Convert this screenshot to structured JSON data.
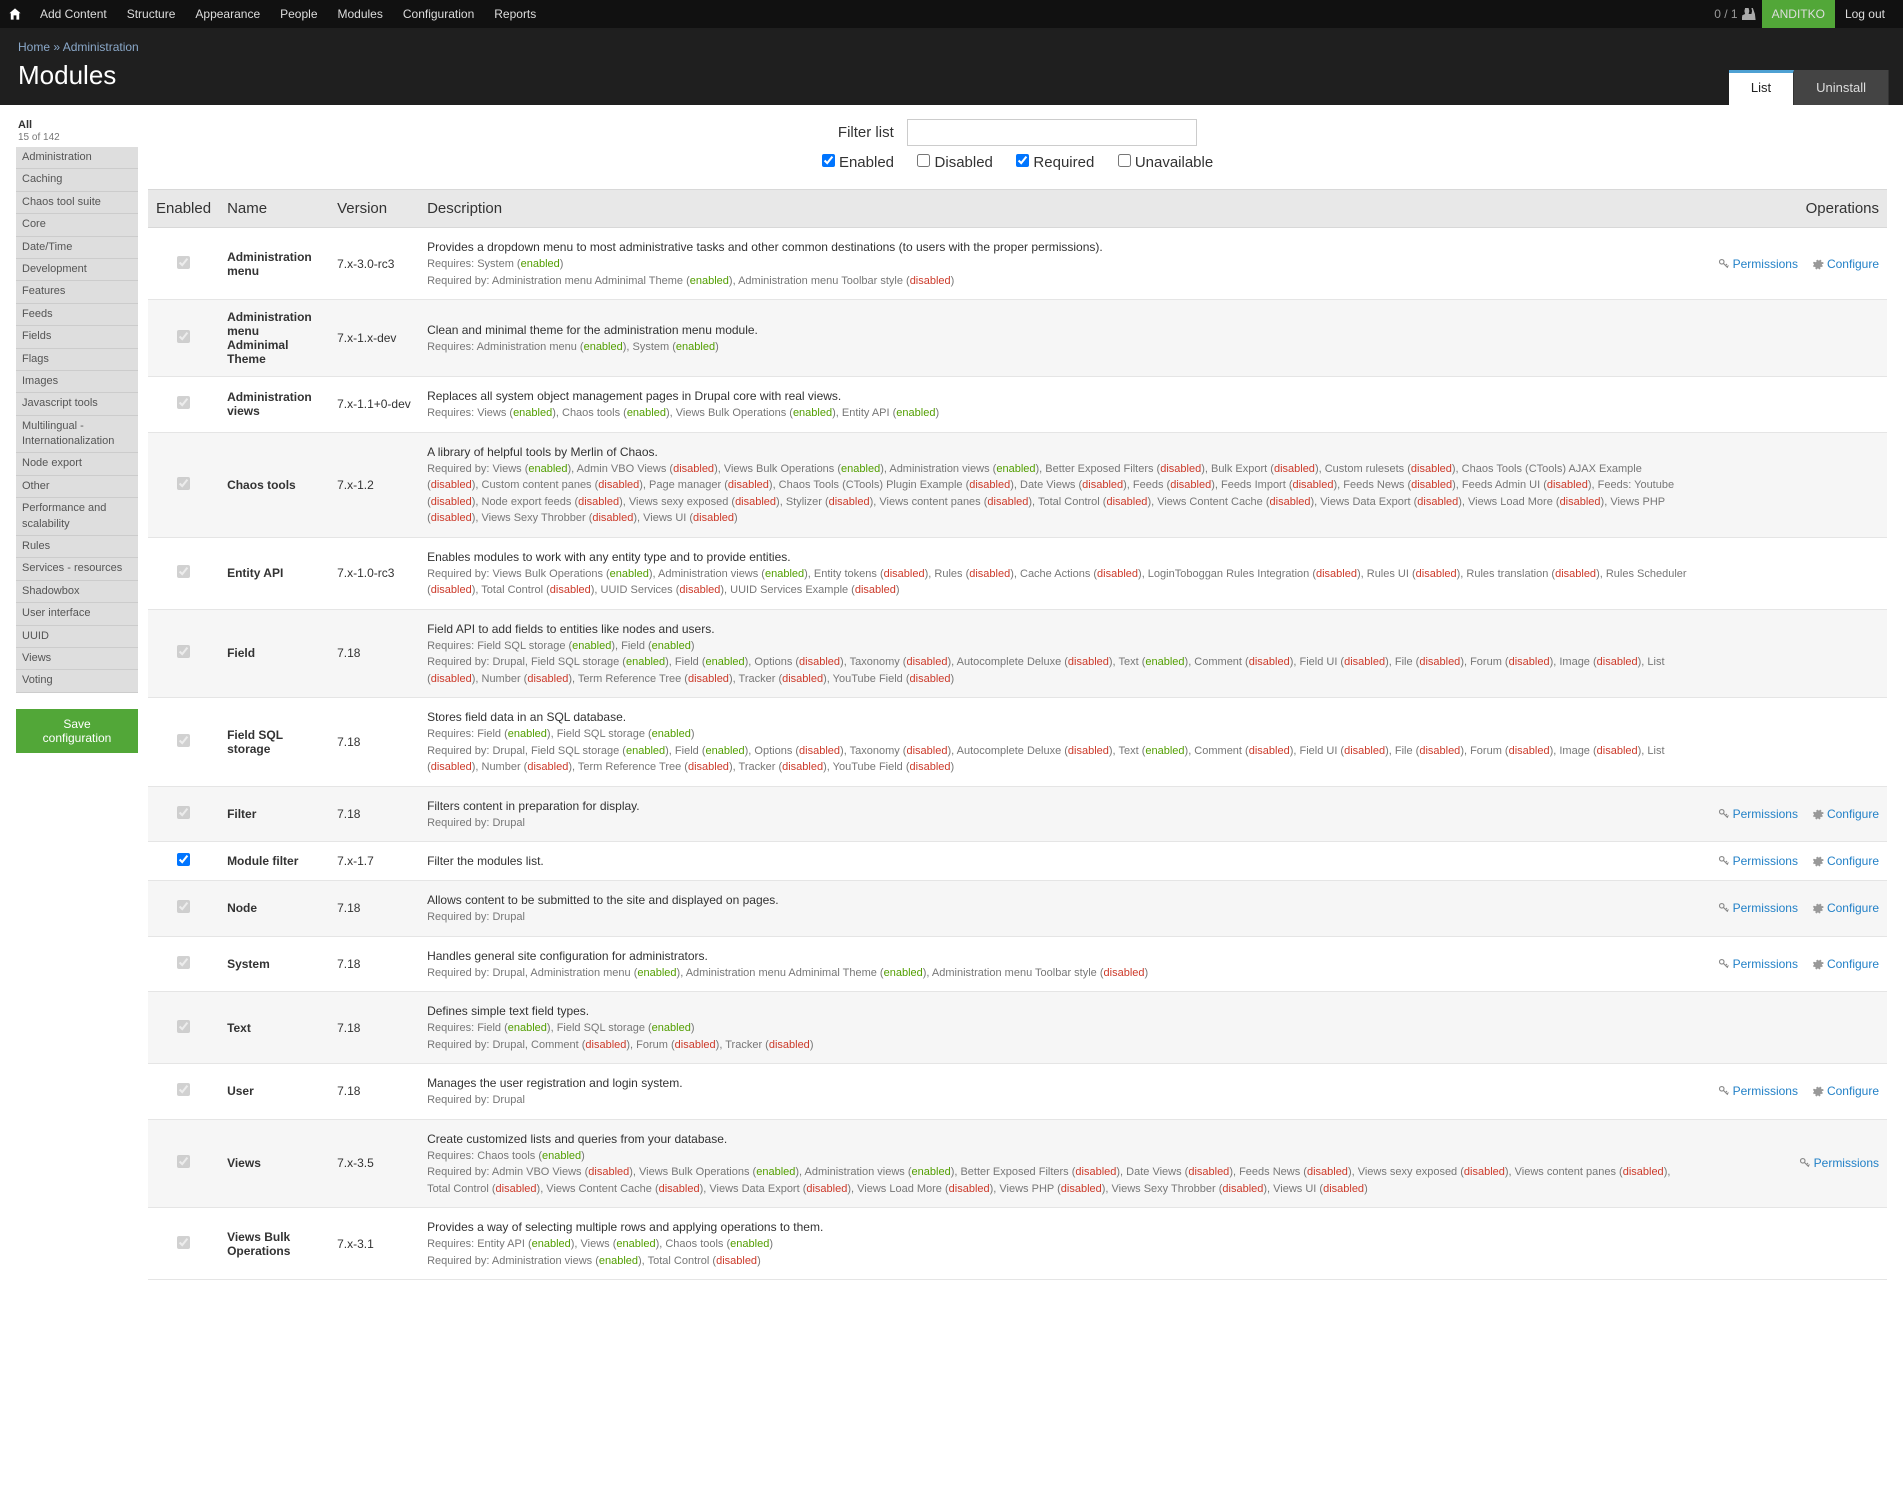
{
  "adminBar": {
    "links": [
      "Add Content",
      "Structure",
      "Appearance",
      "People",
      "Modules",
      "Configuration",
      "Reports"
    ],
    "userCount": "0 / 1",
    "username": "ANDITKO",
    "logout": "Log out"
  },
  "breadcrumb": {
    "home": "Home",
    "sep": " » ",
    "current": "Administration"
  },
  "pageTitle": "Modules",
  "tabs": {
    "list": "List",
    "uninstall": "Uninstall"
  },
  "sidebar": {
    "allLabel": "All",
    "allCount": "15 of 142",
    "items": [
      "Administration",
      "Caching",
      "Chaos tool suite",
      "Core",
      "Date/Time",
      "Development",
      "Features",
      "Feeds",
      "Fields",
      "Flags",
      "Images",
      "Javascript tools",
      "Multilingual - Internationalization",
      "Node export",
      "Other",
      "Performance and scalability",
      "Rules",
      "Services - resources",
      "Shadowbox",
      "User interface",
      "UUID",
      "Views",
      "Voting"
    ],
    "saveBtn": "Save configuration"
  },
  "filter": {
    "label": "Filter list",
    "chkEnabled": "Enabled",
    "chkDisabled": "Disabled",
    "chkRequired": "Required",
    "chkUnavailable": "Unavailable"
  },
  "columns": {
    "enabled": "Enabled",
    "name": "Name",
    "version": "Version",
    "description": "Description",
    "operations": "Operations"
  },
  "ops": {
    "permissions": "Permissions",
    "configure": "Configure"
  },
  "status": {
    "enabled": "enabled",
    "disabled": "disabled"
  },
  "rows": [
    {
      "name": "Administration menu",
      "version": "7.x-3.0-rc3",
      "desc": "Provides a dropdown menu to most administrative tasks and other common destinations (to users with the proper permissions).",
      "reqLines": [
        [
          {
            "t": "Requires: System ("
          },
          {
            "s": "en"
          },
          {
            "t": ")"
          }
        ],
        [
          {
            "t": "Required by: Administration menu Adminimal Theme ("
          },
          {
            "s": "en"
          },
          {
            "t": "), Administration menu Toolbar style ("
          },
          {
            "s": "dis"
          },
          {
            "t": ")"
          }
        ]
      ],
      "ops": [
        "permissions",
        "configure"
      ]
    },
    {
      "name": "Administration menu Adminimal Theme",
      "version": "7.x-1.x-dev",
      "desc": "Clean and minimal theme for the administration menu module.",
      "reqLines": [
        [
          {
            "t": "Requires: Administration menu ("
          },
          {
            "s": "en"
          },
          {
            "t": "), System ("
          },
          {
            "s": "en"
          },
          {
            "t": ")"
          }
        ]
      ],
      "ops": []
    },
    {
      "name": "Administration views",
      "version": "7.x-1.1+0-dev",
      "desc": "Replaces all system object management pages in Drupal core with real views.",
      "reqLines": [
        [
          {
            "t": "Requires: Views ("
          },
          {
            "s": "en"
          },
          {
            "t": "), Chaos tools ("
          },
          {
            "s": "en"
          },
          {
            "t": "), Views Bulk Operations ("
          },
          {
            "s": "en"
          },
          {
            "t": "), Entity API ("
          },
          {
            "s": "en"
          },
          {
            "t": ")"
          }
        ]
      ],
      "ops": []
    },
    {
      "name": "Chaos tools",
      "version": "7.x-1.2",
      "desc": "A library of helpful tools by Merlin of Chaos.",
      "reqLines": [
        [
          {
            "t": "Required by: Views ("
          },
          {
            "s": "en"
          },
          {
            "t": "), Admin VBO Views ("
          },
          {
            "s": "dis"
          },
          {
            "t": "), Views Bulk Operations ("
          },
          {
            "s": "en"
          },
          {
            "t": "), Administration views ("
          },
          {
            "s": "en"
          },
          {
            "t": "), Better Exposed Filters ("
          },
          {
            "s": "dis"
          },
          {
            "t": "), Bulk Export ("
          },
          {
            "s": "dis"
          },
          {
            "t": "), Custom rulesets ("
          },
          {
            "s": "dis"
          },
          {
            "t": "), Chaos Tools (CTools) AJAX Example ("
          },
          {
            "s": "dis"
          },
          {
            "t": "), Custom content panes ("
          },
          {
            "s": "dis"
          },
          {
            "t": "), Page manager ("
          },
          {
            "s": "dis"
          },
          {
            "t": "), Chaos Tools (CTools) Plugin Example ("
          },
          {
            "s": "dis"
          },
          {
            "t": "), Date Views ("
          },
          {
            "s": "dis"
          },
          {
            "t": "), Feeds ("
          },
          {
            "s": "dis"
          },
          {
            "t": "), Feeds Import ("
          },
          {
            "s": "dis"
          },
          {
            "t": "), Feeds News ("
          },
          {
            "s": "dis"
          },
          {
            "t": "), Feeds Admin UI ("
          },
          {
            "s": "dis"
          },
          {
            "t": "), Feeds: Youtube ("
          },
          {
            "s": "dis"
          },
          {
            "t": "), Node export feeds ("
          },
          {
            "s": "dis"
          },
          {
            "t": "), Views sexy exposed ("
          },
          {
            "s": "dis"
          },
          {
            "t": "), Stylizer ("
          },
          {
            "s": "dis"
          },
          {
            "t": "), Views content panes ("
          },
          {
            "s": "dis"
          },
          {
            "t": "), Total Control ("
          },
          {
            "s": "dis"
          },
          {
            "t": "), Views Content Cache ("
          },
          {
            "s": "dis"
          },
          {
            "t": "), Views Data Export ("
          },
          {
            "s": "dis"
          },
          {
            "t": "), Views Load More ("
          },
          {
            "s": "dis"
          },
          {
            "t": "), Views PHP ("
          },
          {
            "s": "dis"
          },
          {
            "t": "), Views Sexy Throbber ("
          },
          {
            "s": "dis"
          },
          {
            "t": "), Views UI ("
          },
          {
            "s": "dis"
          },
          {
            "t": ")"
          }
        ]
      ],
      "ops": []
    },
    {
      "name": "Entity API",
      "version": "7.x-1.0-rc3",
      "desc": "Enables modules to work with any entity type and to provide entities.",
      "reqLines": [
        [
          {
            "t": "Required by: Views Bulk Operations ("
          },
          {
            "s": "en"
          },
          {
            "t": "), Administration views ("
          },
          {
            "s": "en"
          },
          {
            "t": "), Entity tokens ("
          },
          {
            "s": "dis"
          },
          {
            "t": "), Rules ("
          },
          {
            "s": "dis"
          },
          {
            "t": "), Cache Actions ("
          },
          {
            "s": "dis"
          },
          {
            "t": "), LoginToboggan Rules Integration ("
          },
          {
            "s": "dis"
          },
          {
            "t": "), Rules UI ("
          },
          {
            "s": "dis"
          },
          {
            "t": "), Rules translation ("
          },
          {
            "s": "dis"
          },
          {
            "t": "), Rules Scheduler ("
          },
          {
            "s": "dis"
          },
          {
            "t": "), Total Control ("
          },
          {
            "s": "dis"
          },
          {
            "t": "), UUID Services ("
          },
          {
            "s": "dis"
          },
          {
            "t": "), UUID Services Example ("
          },
          {
            "s": "dis"
          },
          {
            "t": ")"
          }
        ]
      ],
      "ops": []
    },
    {
      "name": "Field",
      "version": "7.18",
      "desc": "Field API to add fields to entities like nodes and users.",
      "reqLines": [
        [
          {
            "t": "Requires: Field SQL storage ("
          },
          {
            "s": "en"
          },
          {
            "t": "), Field ("
          },
          {
            "s": "en"
          },
          {
            "t": ")"
          }
        ],
        [
          {
            "t": "Required by: Drupal, Field SQL storage ("
          },
          {
            "s": "en"
          },
          {
            "t": "), Field ("
          },
          {
            "s": "en"
          },
          {
            "t": "), Options ("
          },
          {
            "s": "dis"
          },
          {
            "t": "), Taxonomy ("
          },
          {
            "s": "dis"
          },
          {
            "t": "), Autocomplete Deluxe ("
          },
          {
            "s": "dis"
          },
          {
            "t": "), Text ("
          },
          {
            "s": "en"
          },
          {
            "t": "), Comment ("
          },
          {
            "s": "dis"
          },
          {
            "t": "), Field UI ("
          },
          {
            "s": "dis"
          },
          {
            "t": "), File ("
          },
          {
            "s": "dis"
          },
          {
            "t": "), Forum ("
          },
          {
            "s": "dis"
          },
          {
            "t": "), Image ("
          },
          {
            "s": "dis"
          },
          {
            "t": "), List ("
          },
          {
            "s": "dis"
          },
          {
            "t": "), Number ("
          },
          {
            "s": "dis"
          },
          {
            "t": "), Term Reference Tree ("
          },
          {
            "s": "dis"
          },
          {
            "t": "), Tracker ("
          },
          {
            "s": "dis"
          },
          {
            "t": "), YouTube Field ("
          },
          {
            "s": "dis"
          },
          {
            "t": ")"
          }
        ]
      ],
      "ops": []
    },
    {
      "name": "Field SQL storage",
      "version": "7.18",
      "desc": "Stores field data in an SQL database.",
      "reqLines": [
        [
          {
            "t": "Requires: Field ("
          },
          {
            "s": "en"
          },
          {
            "t": "), Field SQL storage ("
          },
          {
            "s": "en"
          },
          {
            "t": ")"
          }
        ],
        [
          {
            "t": "Required by: Drupal, Field SQL storage ("
          },
          {
            "s": "en"
          },
          {
            "t": "), Field ("
          },
          {
            "s": "en"
          },
          {
            "t": "), Options ("
          },
          {
            "s": "dis"
          },
          {
            "t": "), Taxonomy ("
          },
          {
            "s": "dis"
          },
          {
            "t": "), Autocomplete Deluxe ("
          },
          {
            "s": "dis"
          },
          {
            "t": "), Text ("
          },
          {
            "s": "en"
          },
          {
            "t": "), Comment ("
          },
          {
            "s": "dis"
          },
          {
            "t": "), Field UI ("
          },
          {
            "s": "dis"
          },
          {
            "t": "), File ("
          },
          {
            "s": "dis"
          },
          {
            "t": "), Forum ("
          },
          {
            "s": "dis"
          },
          {
            "t": "), Image ("
          },
          {
            "s": "dis"
          },
          {
            "t": "), List ("
          },
          {
            "s": "dis"
          },
          {
            "t": "), Number ("
          },
          {
            "s": "dis"
          },
          {
            "t": "), Term Reference Tree ("
          },
          {
            "s": "dis"
          },
          {
            "t": "), Tracker ("
          },
          {
            "s": "dis"
          },
          {
            "t": "), YouTube Field ("
          },
          {
            "s": "dis"
          },
          {
            "t": ")"
          }
        ]
      ],
      "ops": []
    },
    {
      "name": "Filter",
      "version": "7.18",
      "desc": "Filters content in preparation for display.",
      "reqLines": [
        [
          {
            "t": "Required by: Drupal"
          }
        ]
      ],
      "ops": [
        "permissions",
        "configure"
      ]
    },
    {
      "name": "Module filter",
      "version": "7.x-1.7",
      "desc": "Filter the modules list.",
      "reqLines": [],
      "ops": [
        "permissions",
        "configure"
      ],
      "unlocked": true
    },
    {
      "name": "Node",
      "version": "7.18",
      "desc": "Allows content to be submitted to the site and displayed on pages.",
      "reqLines": [
        [
          {
            "t": "Required by: Drupal"
          }
        ]
      ],
      "ops": [
        "permissions",
        "configure"
      ]
    },
    {
      "name": "System",
      "version": "7.18",
      "desc": "Handles general site configuration for administrators.",
      "reqLines": [
        [
          {
            "t": "Required by: Drupal, Administration menu ("
          },
          {
            "s": "en"
          },
          {
            "t": "), Administration menu Adminimal Theme ("
          },
          {
            "s": "en"
          },
          {
            "t": "), Administration menu Toolbar style ("
          },
          {
            "s": "dis"
          },
          {
            "t": ")"
          }
        ]
      ],
      "ops": [
        "permissions",
        "configure"
      ]
    },
    {
      "name": "Text",
      "version": "7.18",
      "desc": "Defines simple text field types.",
      "reqLines": [
        [
          {
            "t": "Requires: Field ("
          },
          {
            "s": "en"
          },
          {
            "t": "), Field SQL storage ("
          },
          {
            "s": "en"
          },
          {
            "t": ")"
          }
        ],
        [
          {
            "t": "Required by: Drupal, Comment ("
          },
          {
            "s": "dis"
          },
          {
            "t": "), Forum ("
          },
          {
            "s": "dis"
          },
          {
            "t": "), Tracker ("
          },
          {
            "s": "dis"
          },
          {
            "t": ")"
          }
        ]
      ],
      "ops": []
    },
    {
      "name": "User",
      "version": "7.18",
      "desc": "Manages the user registration and login system.",
      "reqLines": [
        [
          {
            "t": "Required by: Drupal"
          }
        ]
      ],
      "ops": [
        "permissions",
        "configure"
      ]
    },
    {
      "name": "Views",
      "version": "7.x-3.5",
      "desc": "Create customized lists and queries from your database.",
      "reqLines": [
        [
          {
            "t": "Requires: Chaos tools ("
          },
          {
            "s": "en"
          },
          {
            "t": ")"
          }
        ],
        [
          {
            "t": "Required by: Admin VBO Views ("
          },
          {
            "s": "dis"
          },
          {
            "t": "), Views Bulk Operations ("
          },
          {
            "s": "en"
          },
          {
            "t": "), Administration views ("
          },
          {
            "s": "en"
          },
          {
            "t": "), Better Exposed Filters ("
          },
          {
            "s": "dis"
          },
          {
            "t": "), Date Views ("
          },
          {
            "s": "dis"
          },
          {
            "t": "), Feeds News ("
          },
          {
            "s": "dis"
          },
          {
            "t": "), Views sexy exposed ("
          },
          {
            "s": "dis"
          },
          {
            "t": "), Views content panes ("
          },
          {
            "s": "dis"
          },
          {
            "t": "), Total Control ("
          },
          {
            "s": "dis"
          },
          {
            "t": "), Views Content Cache ("
          },
          {
            "s": "dis"
          },
          {
            "t": "), Views Data Export ("
          },
          {
            "s": "dis"
          },
          {
            "t": "), Views Load More ("
          },
          {
            "s": "dis"
          },
          {
            "t": "), Views PHP ("
          },
          {
            "s": "dis"
          },
          {
            "t": "), Views Sexy Throbber ("
          },
          {
            "s": "dis"
          },
          {
            "t": "), Views UI ("
          },
          {
            "s": "dis"
          },
          {
            "t": ")"
          }
        ]
      ],
      "ops": [
        "permissions"
      ]
    },
    {
      "name": "Views Bulk Operations",
      "version": "7.x-3.1",
      "desc": "Provides a way of selecting multiple rows and applying operations to them.",
      "reqLines": [
        [
          {
            "t": "Requires: Entity API ("
          },
          {
            "s": "en"
          },
          {
            "t": "), Views ("
          },
          {
            "s": "en"
          },
          {
            "t": "), Chaos tools ("
          },
          {
            "s": "en"
          },
          {
            "t": ")"
          }
        ],
        [
          {
            "t": "Required by: Administration views ("
          },
          {
            "s": "en"
          },
          {
            "t": "), Total Control ("
          },
          {
            "s": "dis"
          },
          {
            "t": ")"
          }
        ]
      ],
      "ops": []
    }
  ]
}
